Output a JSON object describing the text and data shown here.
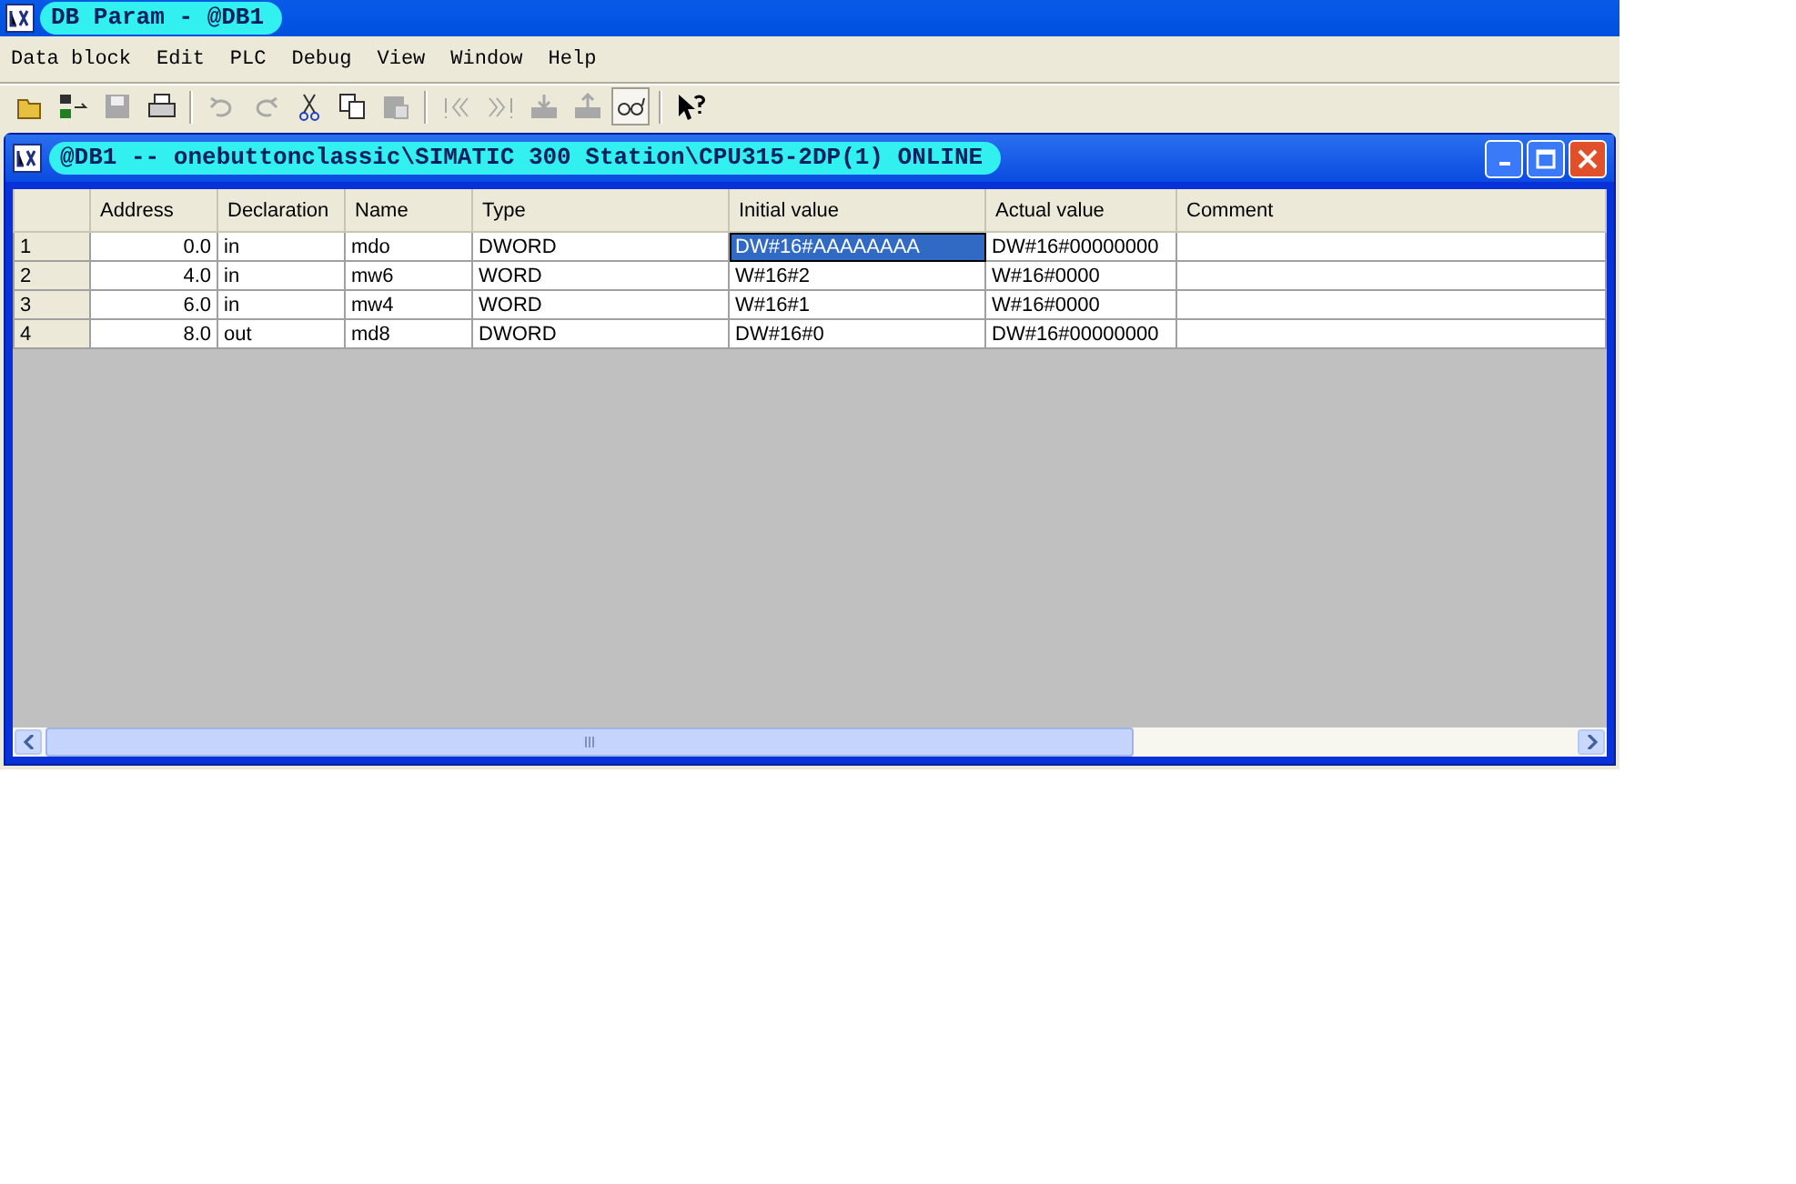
{
  "window": {
    "title": "DB Param - @DB1"
  },
  "menu": [
    "Data block",
    "Edit",
    "PLC",
    "Debug",
    "View",
    "Window",
    "Help"
  ],
  "toolbar": [
    {
      "kind": "open",
      "disabled": false,
      "pressed": false
    },
    {
      "kind": "network",
      "disabled": false,
      "pressed": false
    },
    {
      "kind": "save",
      "disabled": true,
      "pressed": false
    },
    {
      "kind": "print",
      "disabled": false,
      "pressed": false
    },
    {
      "kind": "sep"
    },
    {
      "kind": "undo",
      "disabled": true,
      "pressed": false
    },
    {
      "kind": "redo",
      "disabled": true,
      "pressed": false
    },
    {
      "kind": "cut",
      "disabled": false,
      "pressed": false
    },
    {
      "kind": "copy",
      "disabled": false,
      "pressed": false
    },
    {
      "kind": "paste",
      "disabled": true,
      "pressed": false
    },
    {
      "kind": "sep"
    },
    {
      "kind": "first",
      "disabled": true,
      "pressed": false
    },
    {
      "kind": "last",
      "disabled": true,
      "pressed": false
    },
    {
      "kind": "download",
      "disabled": true,
      "pressed": false
    },
    {
      "kind": "upload",
      "disabled": true,
      "pressed": false
    },
    {
      "kind": "glasses",
      "disabled": false,
      "pressed": true
    },
    {
      "kind": "sep"
    },
    {
      "kind": "help",
      "disabled": false,
      "pressed": false
    }
  ],
  "child_window": {
    "title": "@DB1 -- onebuttonclassic\\SIMATIC 300 Station\\CPU315-2DP(1)  ONLINE"
  },
  "table": {
    "columns": [
      "Address",
      "Declaration",
      "Name",
      "Type",
      "Initial value",
      "Actual value",
      "Comment"
    ],
    "rows": [
      {
        "number": "1",
        "address": "0.0",
        "declaration": "in",
        "name": "mdo",
        "type": "DWORD",
        "initial_value": {
          "text": "DW#16#AAAAAAAA",
          "selected": true
        },
        "actual_value": "DW#16#00000000"
      },
      {
        "number": "2",
        "address": "4.0",
        "declaration": "in",
        "name": "mw6",
        "type": "WORD",
        "initial_value": {
          "text": "W#16#2",
          "selected": false
        },
        "actual_value": "W#16#0000"
      },
      {
        "number": "3",
        "address": "6.0",
        "declaration": "in",
        "name": "mw4",
        "type": "WORD",
        "initial_value": {
          "text": "W#16#1",
          "selected": false
        },
        "actual_value": "W#16#0000"
      },
      {
        "number": "4",
        "address": "8.0",
        "declaration": "out",
        "name": "md8",
        "type": "DWORD",
        "initial_value": {
          "text": "DW#16#0",
          "selected": false
        },
        "actual_value": "DW#16#00000000"
      }
    ]
  }
}
